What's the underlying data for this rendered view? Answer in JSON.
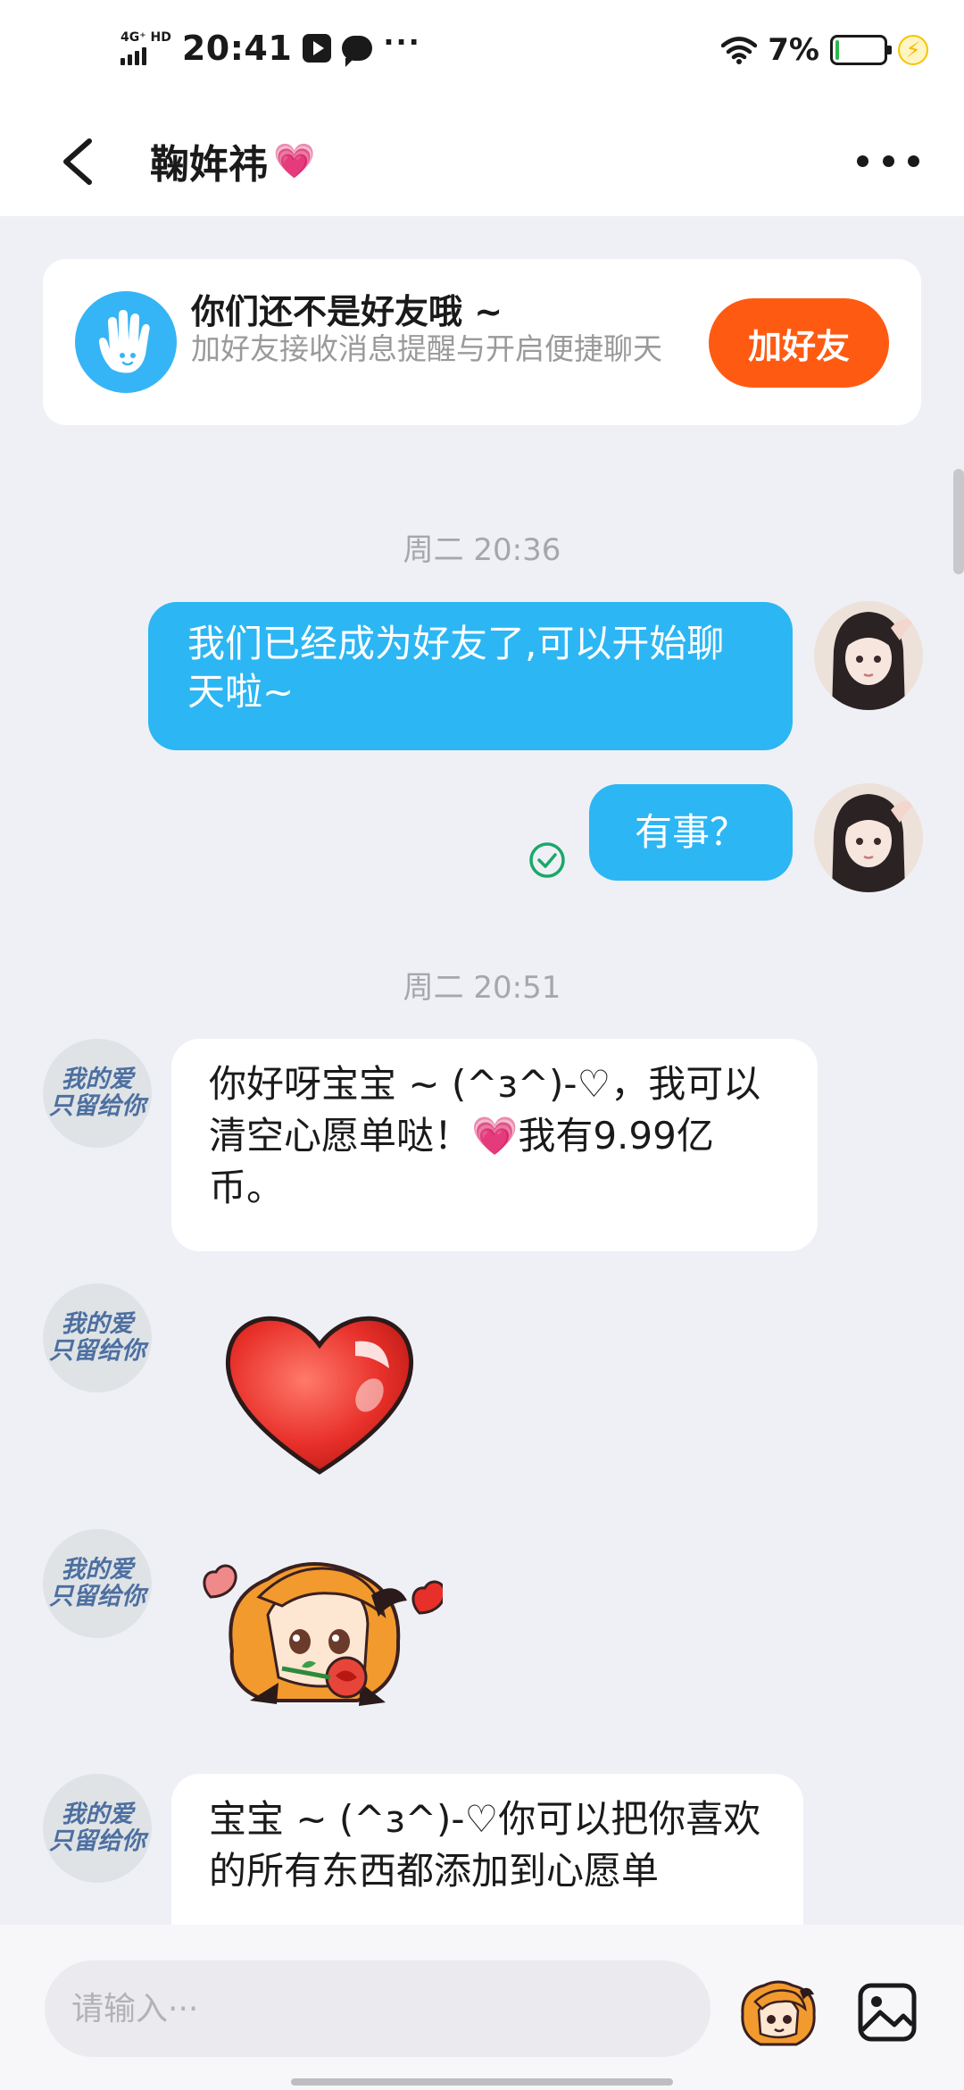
{
  "status_bar": {
    "network": "4G⁺ HD",
    "time": "20:41",
    "more": "···",
    "battery_percent": "7%",
    "battery_level": 0.07,
    "icons": [
      "signal-icon",
      "video-app-icon",
      "message-app-icon",
      "wifi-icon",
      "battery-icon",
      "charging-icon"
    ]
  },
  "header": {
    "title": "鞠姩祎",
    "title_emoji": "💗",
    "back_icon": "back-arrow-icon",
    "more_icon": "more-dots-icon"
  },
  "friend_prompt": {
    "title": "你们还不是好友哦 ~",
    "subtitle": "加好友接收消息提醒与开启便捷聊天",
    "button_label": "加好友",
    "icon": "hand-wave-icon"
  },
  "conversation": {
    "timestamp_1": "周二 20:36",
    "outgoing_1": "我们已经成为好友了,可以开始聊天啦~",
    "outgoing_2": "有事？",
    "read_icon": "check-circle-icon",
    "timestamp_2": "周二 20:51",
    "incoming_1_part1": "你好呀宝宝 ~ (^з^)-♡，我可以清空心愿单哒！",
    "incoming_1_emoji": "💗",
    "incoming_1_part2": "我有9.99亿币。",
    "incoming_4_visible": "宝宝 ~ (^з^)-♡你可以把你喜欢的所有东西都添加到心愿单",
    "contact_avatar_text": [
      "我的爱",
      "只留给你"
    ]
  },
  "input_bar": {
    "placeholder": "请输入···",
    "sticker_icon": "sticker-mascot-icon",
    "image_icon": "image-gallery-icon"
  },
  "colors": {
    "outgoing_bubble": "#2cb6f4",
    "add_friend_button": "#ff5a12",
    "background": "#eff0f5",
    "hand_avatar": "#35b5f5"
  }
}
